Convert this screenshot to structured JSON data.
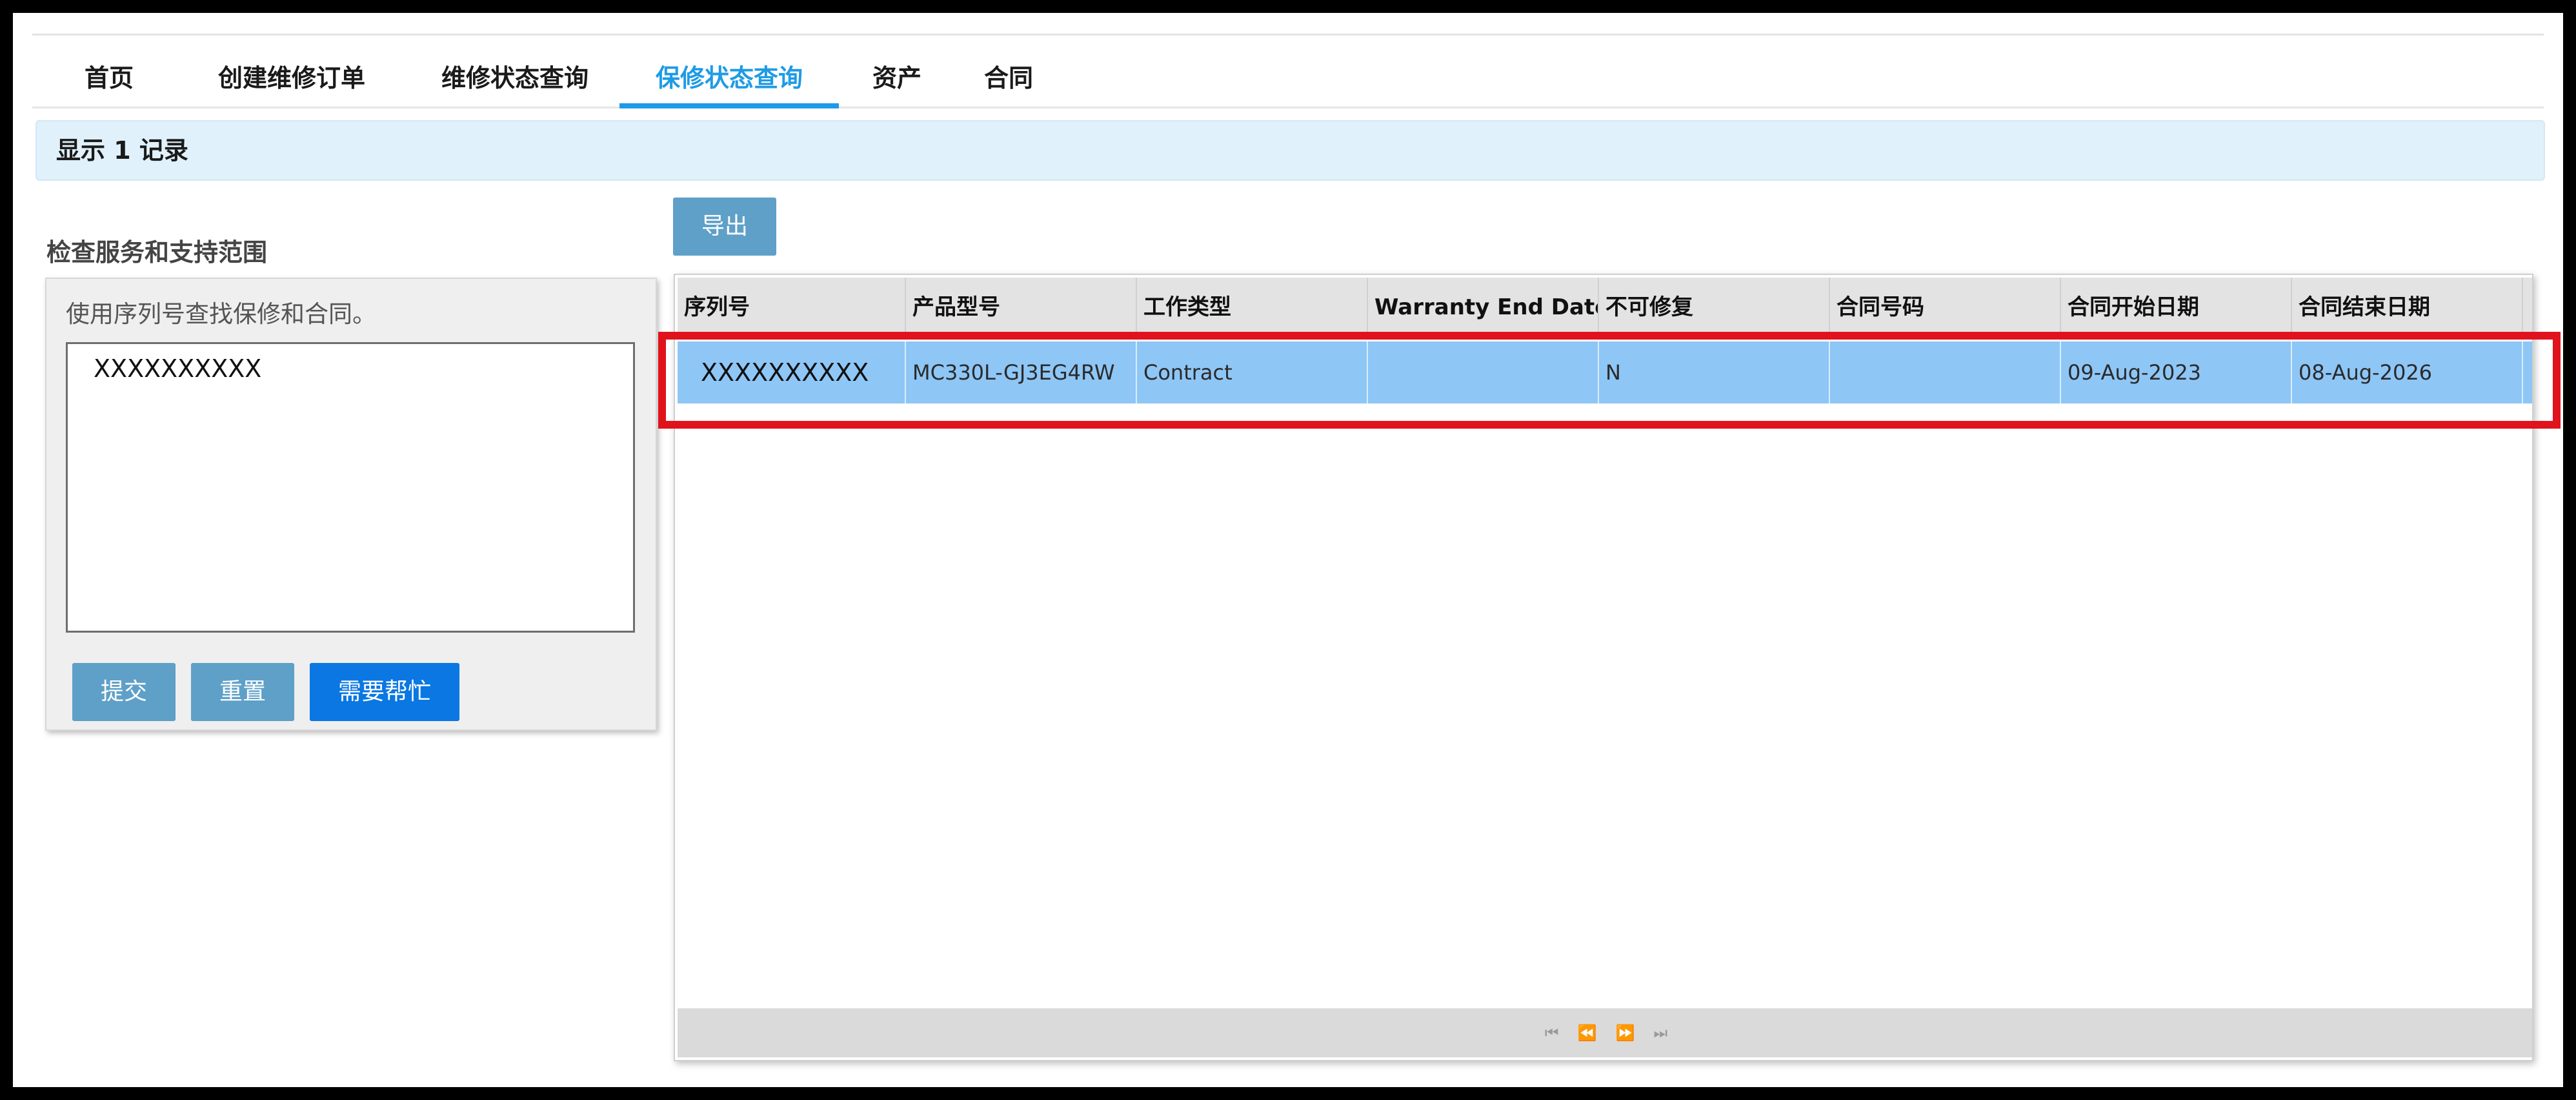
{
  "nav": {
    "items": [
      "首页",
      "创建维修订单",
      "维修状态查询",
      "保修状态查询",
      "资产",
      "合同"
    ],
    "active_index": 3
  },
  "banner": {
    "text": "显示 1 记录"
  },
  "left": {
    "title": "检查服务和支持范围",
    "hint": "使用序列号查找保修和合同。",
    "serial_value": "XXXXXXXXXX",
    "buttons": {
      "submit": "提交",
      "reset": "重置",
      "help": "需要帮忙"
    }
  },
  "toolbar": {
    "export_label": "导出"
  },
  "table": {
    "columns": [
      "序列号",
      "产品型号",
      "工作类型",
      "Warranty End Date",
      "不可修复",
      "合同号码",
      "合同开始日期",
      "合同结束日期"
    ],
    "rows": [
      [
        "XXXXXXXXXX",
        "MC330L-GJ3EG4RW",
        "Contract",
        "",
        "N",
        "",
        "09-Aug-2023",
        "08-Aug-2026"
      ]
    ]
  },
  "pager": {
    "first": "⏮",
    "prev": "⏪",
    "next": "⏩",
    "last": "⏭"
  },
  "colors": {
    "accent": "#1e9be6",
    "row_selected": "#8ec6f6",
    "highlight": "#e0121c",
    "primary_button": "#0a77e3"
  }
}
